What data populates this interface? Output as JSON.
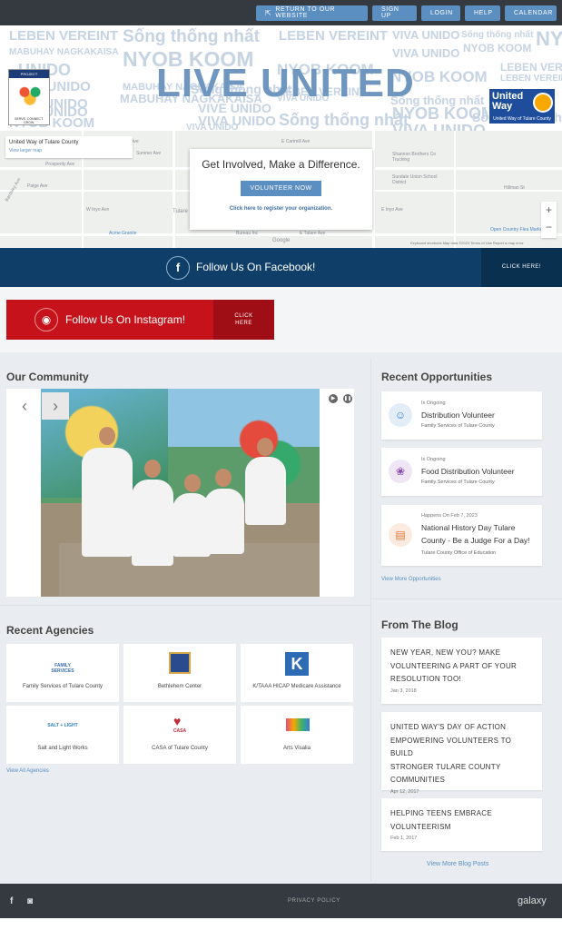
{
  "topbar": {
    "buttons": [
      {
        "label": "RETURN TO OUR WEBSITE",
        "icon": "external-link-icon"
      },
      {
        "label": "SIGN UP"
      },
      {
        "label": "LOGIN"
      },
      {
        "label": "HELP"
      },
      {
        "label": "CALENDAR"
      }
    ]
  },
  "hero": {
    "title": "LIVE UNITED",
    "background_words": [
      "LEBEN VEREINT",
      "Sống thống nhất",
      "LEBEN VEREINT",
      "VIVA UNIDO",
      "Sống thống nhất",
      "NY",
      "MABUHAY NAGKAKAISA",
      "NYOB KOOM",
      "VIVA UNIDO",
      "NYOB KOOM",
      "UNIDO",
      "NYOB KOOM",
      "LEBEN VEREINT",
      "NYOB KOOM",
      "VIVA UNIDO",
      "MABUHAY NAGKAKAISA",
      "LEBEN VEREINT",
      "MABUHAY NAGKAKAISA",
      "LEBEN VEREINT",
      "VIVE UNIDO",
      "Sống thống nhất",
      "Sống thống nhất",
      "VIVE UNIDO",
      "VIVE UNIDO",
      "VIVA UNIDO",
      "NYOB KOOM",
      "NYOB KOOM",
      "VIVA UNIDO",
      "Sống thống nhất",
      "VIVA UNIDO",
      "VIVA UNIDO",
      "Sống thống nhất"
    ],
    "logo_left_top": "PROJECT VOLUNTEER",
    "logo_left_bottom": "SERVE. CONNECT. GROW.",
    "logo_right_name": "United Way",
    "logo_right_caption": "United Way of Tulare County"
  },
  "map": {
    "place_name": "United Way of Tulare County",
    "larger_map": "View larger map",
    "labels": [
      "W Cartmill Ave",
      "E Cartmill Ave",
      "Sumner Ave",
      "Shannon Brothers Co Trucking",
      "Sundale Union School District",
      "Prosperity Ave",
      "Tulare",
      "Bureau Inc",
      "Acme Granite",
      "Open Country Flea Market",
      "W Inyo Ave",
      "E Inyo Ave",
      "Paige Ave",
      "Bardsley Ave",
      "Hillman St",
      "E Tulare Ave"
    ],
    "attribution": "Keyboard shortcuts   Map data ©2023   Terms of Use   Report a map error",
    "google": "Google",
    "zoom_in": "+",
    "zoom_out": "−"
  },
  "involve": {
    "heading": "Get Involved, Make a Difference.",
    "button": "VOLUNTEER NOW",
    "register": "Click here to register your organization."
  },
  "facebook": {
    "icon": "f",
    "text": "Follow Us On Facebook!",
    "cta": "CLICK HERE!"
  },
  "instagram": {
    "icon": "◉",
    "text": "Follow Us On Instagram!",
    "cta_line1": "CLICK",
    "cta_line2": "HERE"
  },
  "community": {
    "title": "Our Community",
    "prev": "‹",
    "next": "›",
    "play": "▶",
    "pause": "❚❚"
  },
  "opportunities": {
    "title": "Recent Opportunities",
    "items": [
      {
        "status": "Is Ongoing",
        "title_lines": [
          "Distribution Volunteer"
        ],
        "org": "Family Services of Tulare County",
        "icon": "person-icon",
        "icon_color": "#3a7bd5",
        "icon_bg": "#e3edf8"
      },
      {
        "status": "Is Ongoing",
        "title_lines": [
          "Food Distribution Volunteer"
        ],
        "org": "Family Services of Tulare County",
        "icon": "grapes-icon",
        "icon_color": "#8a4bb3",
        "icon_bg": "#efe5f5"
      },
      {
        "status": "Happens On Feb 7, 2023",
        "title_lines": [
          "National History Day Tulare",
          "County - Be a Judge For a Day!"
        ],
        "org": "Tulare County Office of Education",
        "icon": "book-icon",
        "icon_color": "#d9783a",
        "icon_bg": "#fbeadf"
      }
    ],
    "view_more": "View More Opportunities"
  },
  "agencies": {
    "title": "Recent Agencies",
    "items": [
      {
        "name": "Family Services of Tulare County",
        "logo_text": "FAMILY SERVICES",
        "logo_color": "#3b6fb5"
      },
      {
        "name": "Bethlehem Center",
        "logo_text": "",
        "logo_color": "#2a4b8d"
      },
      {
        "name": "K/TAAA HICAP Medicare Assistance",
        "logo_text": "K",
        "logo_color": "#2d6cb5"
      },
      {
        "name": "Salt and Light Works",
        "logo_text": "SALT + LIGHT",
        "logo_color": "#2d7fb8"
      },
      {
        "name": "CASA of Tulare County",
        "logo_text": "CASA",
        "logo_color": "#c02a3a"
      },
      {
        "name": "Arts Visalia",
        "logo_text": "",
        "logo_color": "#e54b7c"
      }
    ],
    "view_all": "View All Agencies"
  },
  "blog": {
    "title": "From The Blog",
    "posts": [
      {
        "title_lines": [
          "NEW YEAR, NEW YOU? MAKE",
          "VOLUNTEERING A PART OF YOUR",
          "RESOLUTION TOO!"
        ],
        "date": "Jan 3, 2018"
      },
      {
        "title_lines": [
          "UNITED WAY'S DAY OF ACTION",
          "EMPOWERING VOLUNTEERS TO BUILD",
          "STRONGER TULARE COUNTY",
          "COMMUNITIES"
        ],
        "date": "Apr 12, 2017"
      },
      {
        "title_lines": [
          "HELPING TEENS EMBRACE",
          "VOLUNTEERISM"
        ],
        "date": "Feb 1, 2017"
      }
    ],
    "view_more": "View More Blog Posts"
  },
  "footer": {
    "facebook": "f",
    "instagram": "◙",
    "privacy": "PRIVACY POLICY",
    "brand": "galaxy"
  },
  "colors": {
    "accent": "#5b8ec1",
    "topbar": "#343a40",
    "facebook": "#0f3f68",
    "instagram": "#c6131b"
  }
}
